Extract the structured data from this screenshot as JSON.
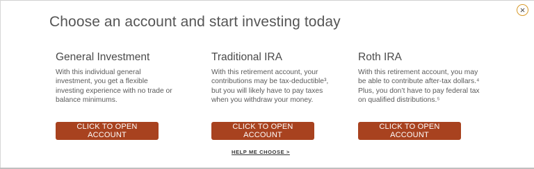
{
  "title": "Choose an account and start investing today",
  "close_icon": "×",
  "accounts": [
    {
      "name": "General Investment",
      "description": "With this individual general investment, you get a flexible investing experience with no trade or balance minimums.",
      "button_label": "CLICK TO OPEN ACCOUNT"
    },
    {
      "name": "Traditional IRA",
      "description": "With this retirement account, your contributions may be tax-deductible³, but you will likely have to pay taxes when you withdraw your money.",
      "button_label": "CLICK TO OPEN ACCOUNT"
    },
    {
      "name": "Roth IRA",
      "description": "With this retirement account, you may be able to contribute after-tax dollars.⁴ Plus, you don’t have to pay federal tax on qualified distributions.⁵",
      "button_label": "CLICK TO OPEN ACCOUNT"
    }
  ],
  "help_link": "HELP ME CHOOSE  >",
  "colors": {
    "button_bg": "#a8421f",
    "close_ring": "#d89a2a"
  }
}
